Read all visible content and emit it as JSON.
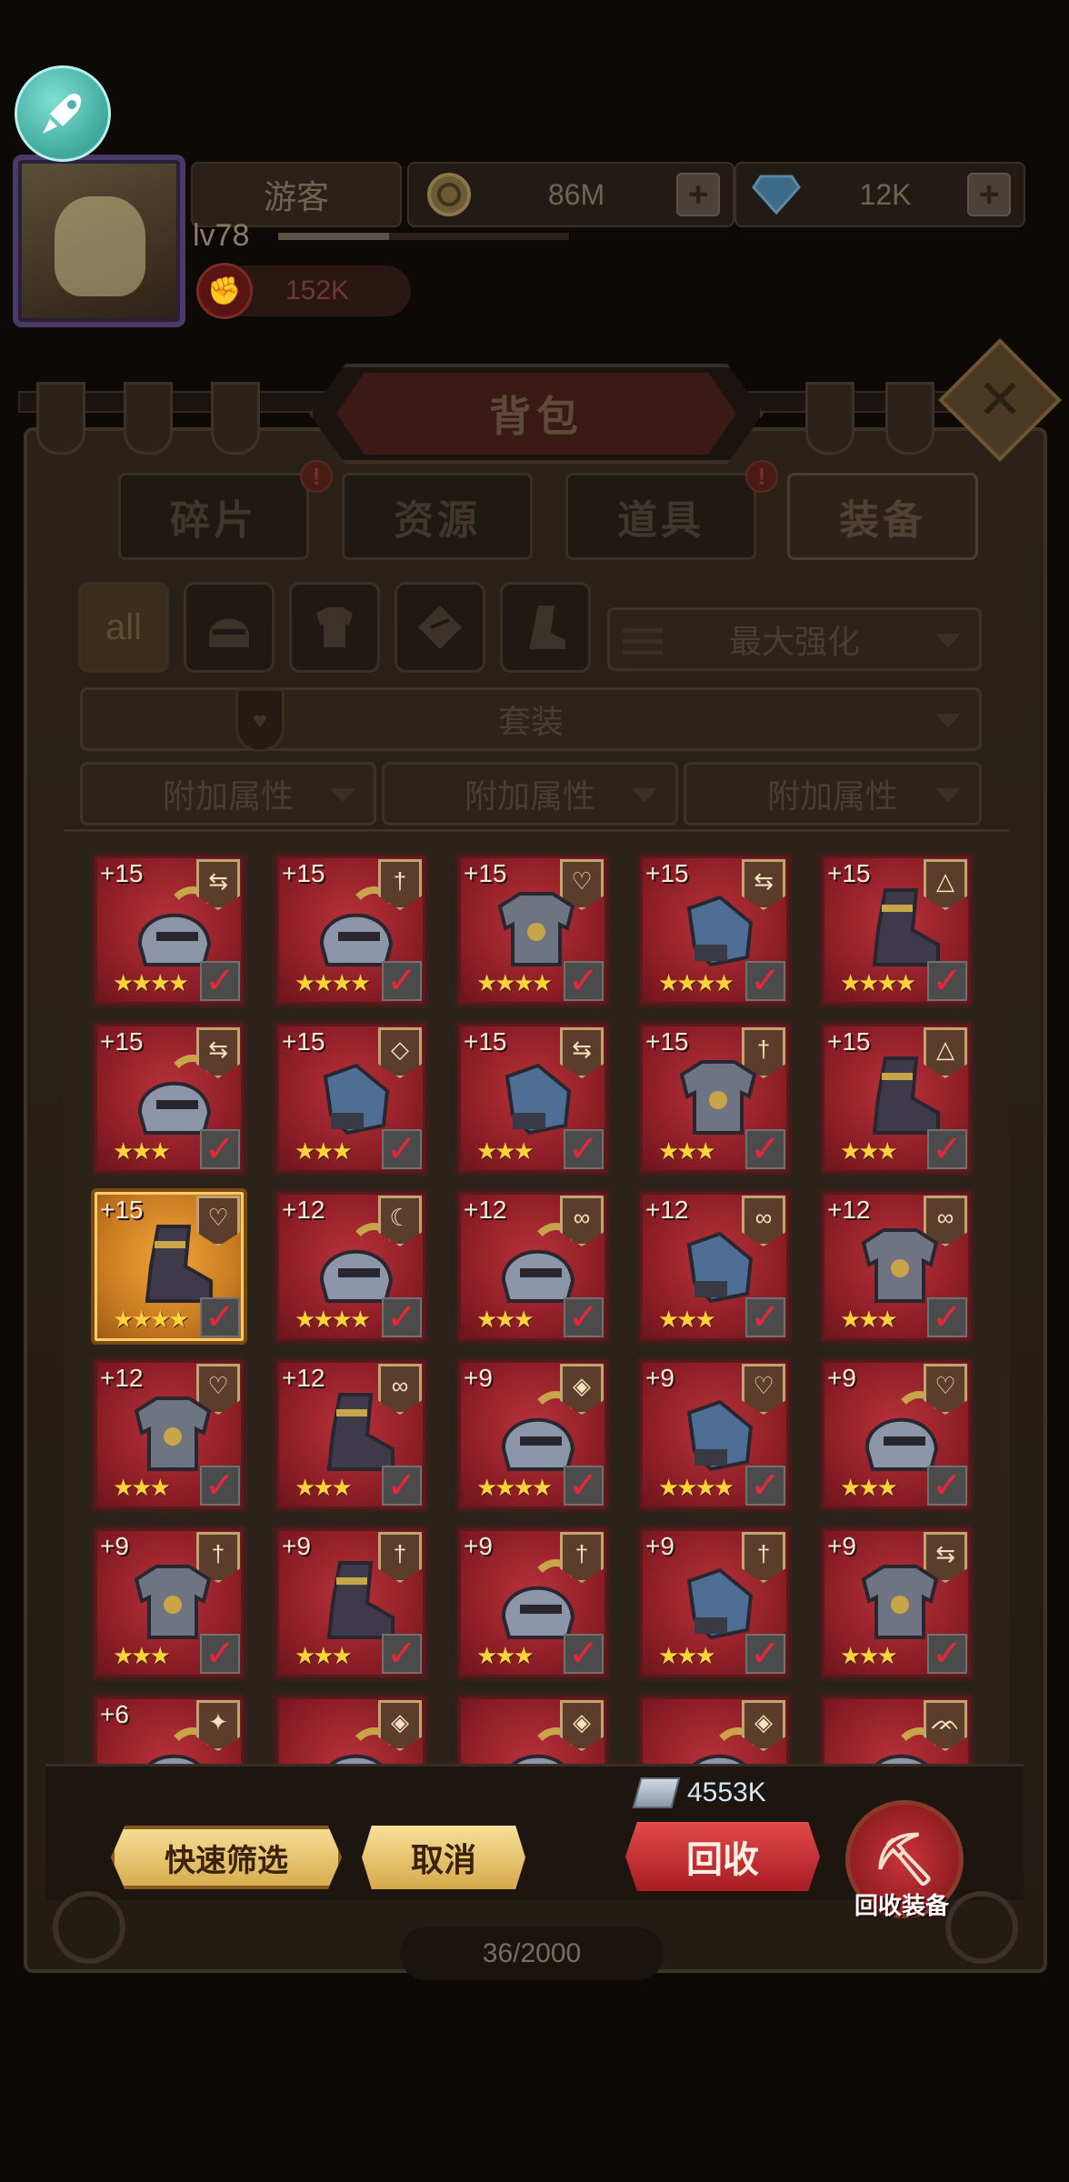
{
  "hud": {
    "player_name": "游客",
    "level": "lv78",
    "exp_fraction": 0.38,
    "power": "152K",
    "gold": "86M",
    "gems": "12K"
  },
  "panel": {
    "title": "背包",
    "tabs": [
      {
        "label": "碎片",
        "alert": "!"
      },
      {
        "label": "资源",
        "alert": ""
      },
      {
        "label": "道具",
        "alert": "!"
      },
      {
        "label": "装备",
        "alert": ""
      }
    ],
    "filters": {
      "all_label": "all",
      "sort_dropdown": "最大强化",
      "set_dropdown": "套装",
      "attr_dropdowns": [
        "附加属性",
        "附加属性",
        "附加属性"
      ]
    }
  },
  "items": [
    {
      "level": "+15",
      "badge": "⇆",
      "stars": "★★★★",
      "check": "✓",
      "type": "helmet",
      "gold": false
    },
    {
      "level": "+15",
      "badge": "†",
      "stars": "★★★★",
      "check": "✓",
      "type": "helmet",
      "gold": false
    },
    {
      "level": "+15",
      "badge": "♡",
      "stars": "★★★★",
      "check": "✓",
      "type": "armor",
      "gold": false
    },
    {
      "level": "+15",
      "badge": "⇆",
      "stars": "★★★★",
      "check": "✓",
      "type": "glove",
      "gold": false
    },
    {
      "level": "+15",
      "badge": "△",
      "stars": "★★★★",
      "check": "✓",
      "type": "boot",
      "gold": false
    },
    {
      "level": "+15",
      "badge": "⇆",
      "stars": "★★★",
      "check": "✓",
      "type": "helmet",
      "gold": false
    },
    {
      "level": "+15",
      "badge": "◇",
      "stars": "★★★",
      "check": "✓",
      "type": "glove",
      "gold": false
    },
    {
      "level": "+15",
      "badge": "⇆",
      "stars": "★★★",
      "check": "✓",
      "type": "glove",
      "gold": false
    },
    {
      "level": "+15",
      "badge": "†",
      "stars": "★★★",
      "check": "✓",
      "type": "armor",
      "gold": false
    },
    {
      "level": "+15",
      "badge": "△",
      "stars": "★★★",
      "check": "✓",
      "type": "boot",
      "gold": false
    },
    {
      "level": "+15",
      "badge": "♡",
      "stars": "★★★★",
      "check": "✓",
      "type": "boot",
      "gold": true
    },
    {
      "level": "+12",
      "badge": "☾",
      "stars": "★★★★",
      "check": "✓",
      "type": "helmet",
      "gold": false
    },
    {
      "level": "+12",
      "badge": "∞",
      "stars": "★★★",
      "check": "✓",
      "type": "helmet",
      "gold": false
    },
    {
      "level": "+12",
      "badge": "∞",
      "stars": "★★★",
      "check": "✓",
      "type": "glove",
      "gold": false
    },
    {
      "level": "+12",
      "badge": "∞",
      "stars": "★★★",
      "check": "✓",
      "type": "armor",
      "gold": false
    },
    {
      "level": "+12",
      "badge": "♡",
      "stars": "★★★",
      "check": "✓",
      "type": "armor",
      "gold": false
    },
    {
      "level": "+12",
      "badge": "∞",
      "stars": "★★★",
      "check": "✓",
      "type": "boot",
      "gold": false
    },
    {
      "level": "+9",
      "badge": "◈",
      "stars": "★★★★",
      "check": "✓",
      "type": "helmet",
      "gold": false
    },
    {
      "level": "+9",
      "badge": "♡",
      "stars": "★★★★",
      "check": "✓",
      "type": "glove",
      "gold": false
    },
    {
      "level": "+9",
      "badge": "♡",
      "stars": "★★★",
      "check": "✓",
      "type": "helmet",
      "gold": false
    },
    {
      "level": "+9",
      "badge": "†",
      "stars": "★★★",
      "check": "✓",
      "type": "armor",
      "gold": false
    },
    {
      "level": "+9",
      "badge": "†",
      "stars": "★★★",
      "check": "✓",
      "type": "boot",
      "gold": false
    },
    {
      "level": "+9",
      "badge": "†",
      "stars": "★★★",
      "check": "✓",
      "type": "helmet",
      "gold": false
    },
    {
      "level": "+9",
      "badge": "†",
      "stars": "★★★",
      "check": "✓",
      "type": "glove",
      "gold": false
    },
    {
      "level": "+9",
      "badge": "⇆",
      "stars": "★★★",
      "check": "✓",
      "type": "armor",
      "gold": false
    },
    {
      "level": "+6",
      "badge": "✦",
      "stars": "",
      "check": "",
      "type": "helmet",
      "gold": false
    },
    {
      "level": "",
      "badge": "◈",
      "stars": "",
      "check": "",
      "type": "helmet",
      "gold": false
    },
    {
      "level": "",
      "badge": "◈",
      "stars": "",
      "check": "",
      "type": "helmet",
      "gold": false
    },
    {
      "level": "",
      "badge": "◈",
      "stars": "",
      "check": "",
      "type": "helmet",
      "gold": false
    },
    {
      "level": "",
      "badge": "ᨏ",
      "stars": "",
      "check": "",
      "type": "helmet",
      "gold": false
    }
  ],
  "bottom": {
    "resource_amount": "4553K",
    "quick_filter_label": "快速筛选",
    "cancel_label": "取消",
    "recycle_label": "回收",
    "recycle_equipment_label": "回收装备",
    "capacity": "36/2000"
  },
  "colors": {
    "item_red": "#8e1e27",
    "item_gold": "#c97b21",
    "recycle_red": "#c8343a",
    "star_yellow": "#ffd23c"
  }
}
